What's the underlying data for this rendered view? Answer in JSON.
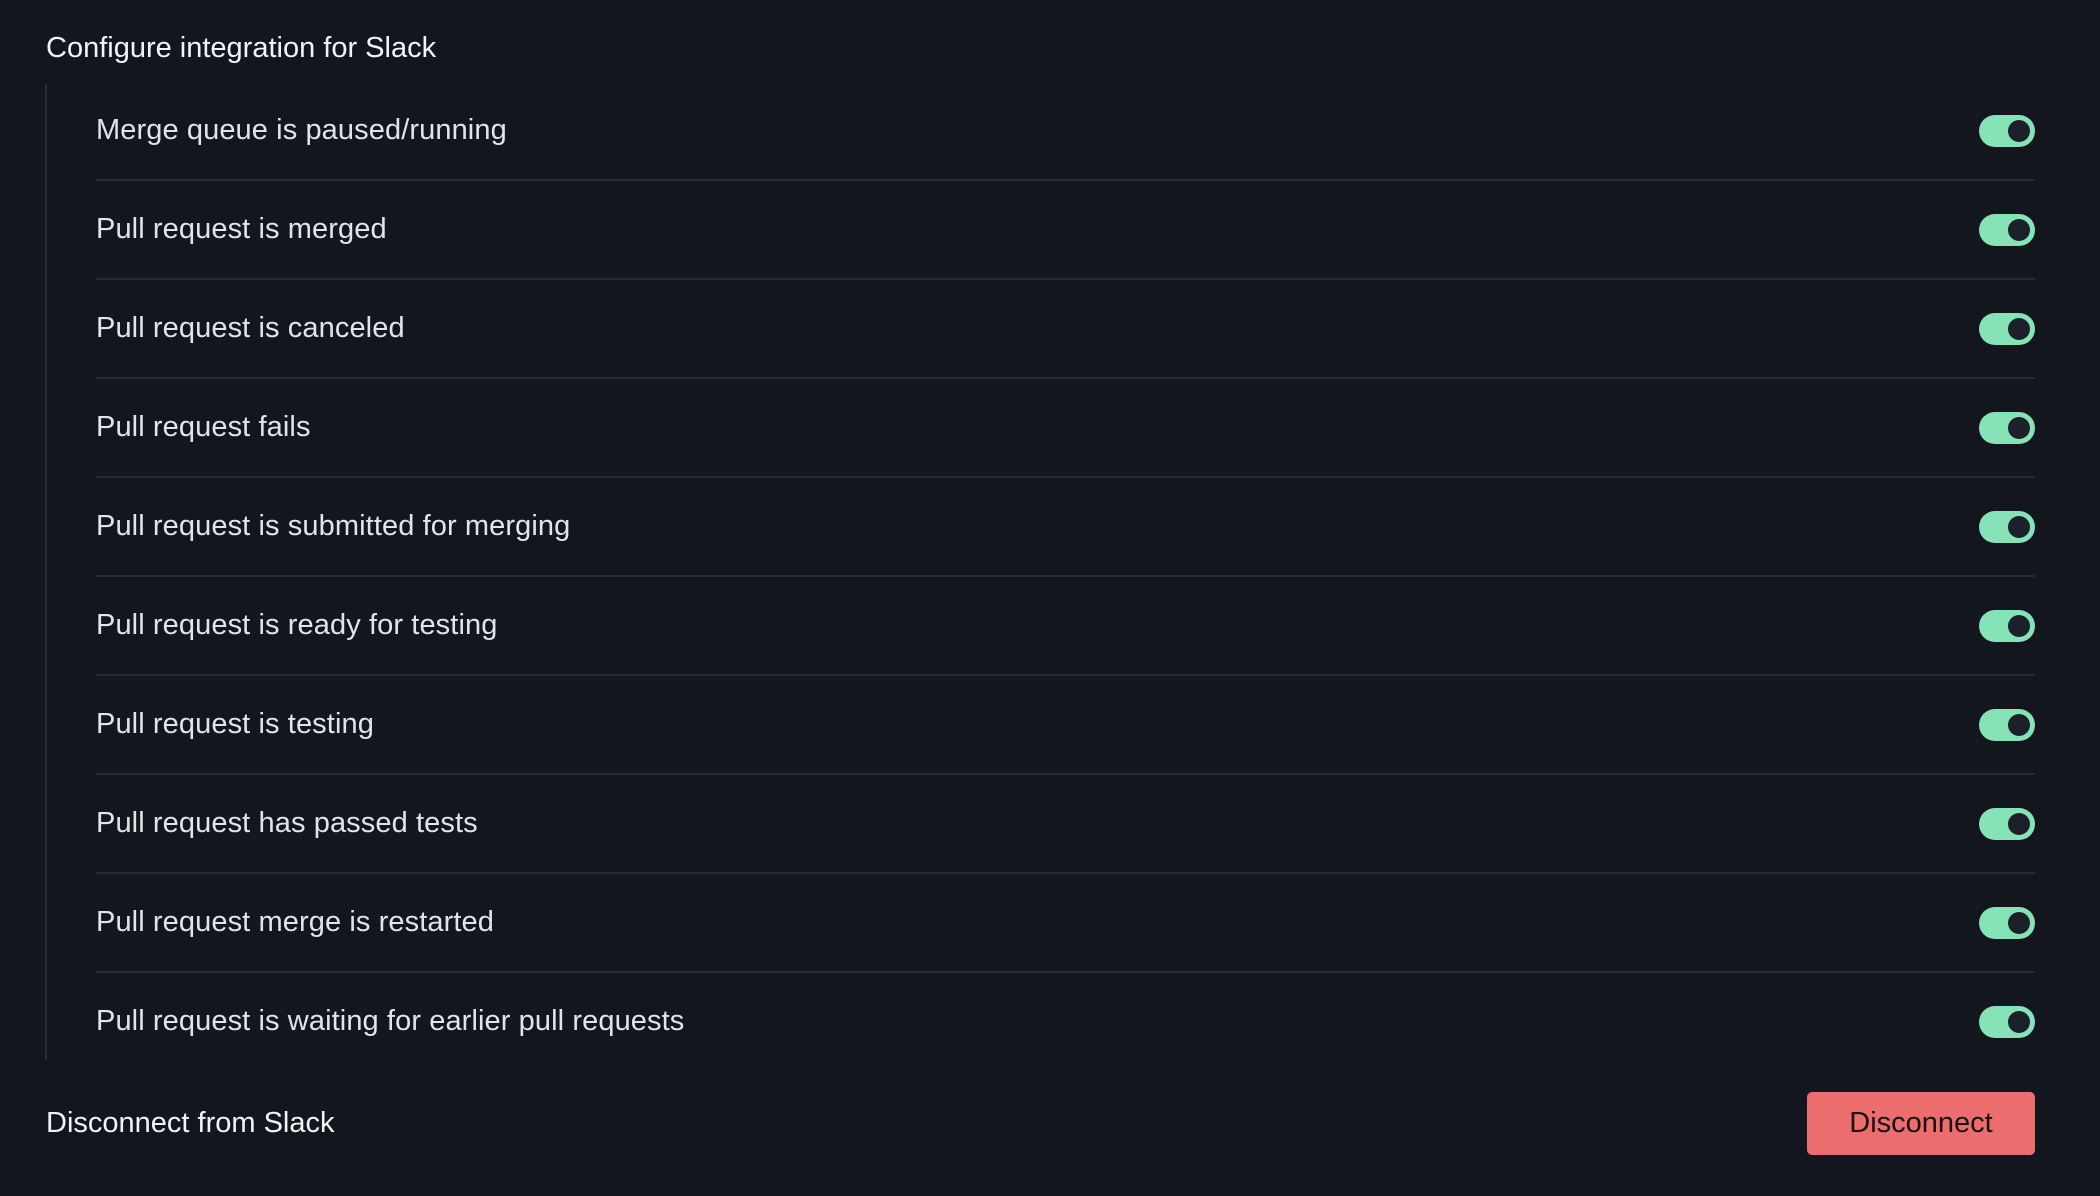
{
  "colors": {
    "background": "#13161d",
    "toggle_on": "#86e3b7",
    "danger": "#ec6d6d"
  },
  "integration": {
    "title": "Configure integration for Slack",
    "notifications": [
      {
        "label": "Merge queue is paused/running",
        "enabled": true
      },
      {
        "label": "Pull request is merged",
        "enabled": true
      },
      {
        "label": "Pull request is canceled",
        "enabled": true
      },
      {
        "label": "Pull request fails",
        "enabled": true
      },
      {
        "label": "Pull request is submitted for merging",
        "enabled": true
      },
      {
        "label": "Pull request is ready for testing",
        "enabled": true
      },
      {
        "label": "Pull request is testing",
        "enabled": true
      },
      {
        "label": "Pull request has passed tests",
        "enabled": true
      },
      {
        "label": "Pull request merge is restarted",
        "enabled": true
      },
      {
        "label": "Pull request is waiting for earlier pull requests",
        "enabled": true
      }
    ]
  },
  "disconnect": {
    "label": "Disconnect from Slack",
    "button_label": "Disconnect"
  }
}
